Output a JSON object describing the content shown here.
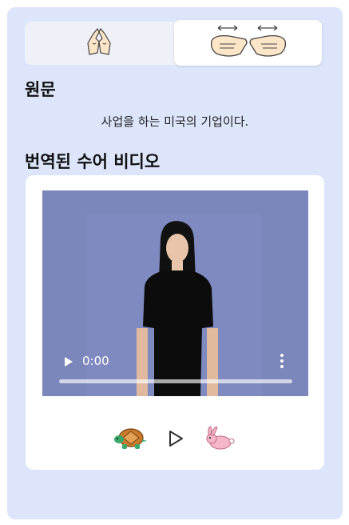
{
  "tabs": [
    {
      "icon": "sign-hands-icon",
      "selected": false
    },
    {
      "icon": "sign-translate-hands-icon",
      "selected": true
    }
  ],
  "source": {
    "heading": "원문",
    "text": "사업을 하는 미국의 기업이다."
  },
  "video_section": {
    "heading": "번역된 수어 비디오",
    "player": {
      "time": "0:00",
      "progress": 0
    }
  },
  "speed_controls": [
    {
      "icon": "turtle-slow-icon"
    },
    {
      "icon": "play-icon"
    },
    {
      "icon": "rabbit-fast-icon"
    }
  ],
  "colors": {
    "panel": "#dde5fb",
    "video_bg": "#7b86bb"
  }
}
